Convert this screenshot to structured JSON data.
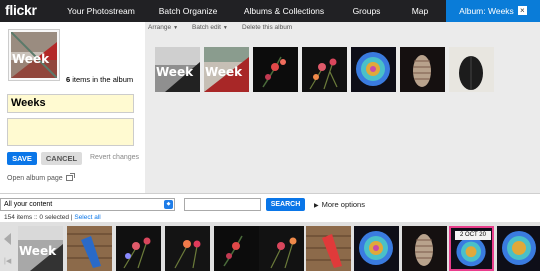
{
  "nav": {
    "logo": "flickr",
    "tabs": [
      {
        "label": "Your Photostream"
      },
      {
        "label": "Batch Organize"
      },
      {
        "label": "Albums & Collections"
      },
      {
        "label": "Groups"
      },
      {
        "label": "Map"
      },
      {
        "label": "Album: Weeks",
        "active": true
      }
    ],
    "close_glyph": "×"
  },
  "album_panel": {
    "count_number": "6",
    "count_suffix": " items in the album",
    "title_value": "Weeks",
    "description_value": "",
    "save_label": "SAVE",
    "cancel_label": "CANCEL",
    "revert_label": "Revert changes",
    "open_page_label": "Open album page"
  },
  "album_toolbar": {
    "arrange_label": "Arrange",
    "batch_edit_label": "Batch edit",
    "delete_label": "Delete this album",
    "caret": "▼"
  },
  "album_photos": [
    {
      "kind": "week"
    },
    {
      "kind": "week"
    },
    {
      "kind": "berry"
    },
    {
      "kind": "flower"
    },
    {
      "kind": "burst"
    },
    {
      "kind": "pinecone"
    },
    {
      "kind": "seed"
    }
  ],
  "filter": {
    "select_value": "All your content",
    "search_placeholder": "",
    "search_label": "SEARCH",
    "more_options_label": "More options",
    "items_count": "154 items :: 0 selected",
    "select_all_label": "Select all"
  },
  "strip": {
    "photos": [
      {
        "kind": "week"
      },
      {
        "kind": "hammer"
      },
      {
        "kind": "flower"
      },
      {
        "kind": "flower"
      },
      {
        "kind": "berry"
      },
      {
        "kind": "flower"
      },
      {
        "kind": "hammer"
      },
      {
        "kind": "burst"
      },
      {
        "kind": "pinecone"
      },
      {
        "kind": "burst",
        "date": "2 OCT 20",
        "selected": true
      },
      {
        "kind": "burst"
      }
    ]
  },
  "colors": {
    "nav_bg": "#212124",
    "active_tab": "#0a7cd8",
    "accent_blue": "#0a76e8",
    "field_yellow": "#fffad1",
    "selected_border": "#e83e8c"
  }
}
